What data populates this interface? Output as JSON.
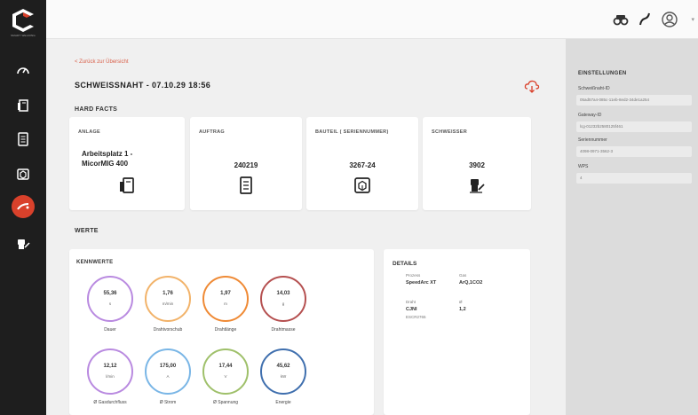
{
  "brand": {
    "logo_text": "SMART WELDING",
    "accent": "#d9412b"
  },
  "sidebar": {
    "items": [
      {
        "icon": "gauge-icon"
      },
      {
        "icon": "machine-icon"
      },
      {
        "icon": "document-icon"
      },
      {
        "icon": "package-icon"
      },
      {
        "icon": "weld-torch-icon",
        "active": true
      },
      {
        "icon": "welder-icon"
      }
    ]
  },
  "topbar": {
    "icons": [
      "binoculars-icon",
      "torch-icon",
      "user-icon"
    ]
  },
  "main": {
    "back_link": "< Zurück zur Übersicht",
    "title": "SCHWEISSNAHT - 07.10.29 18:56",
    "hard_facts_label": "HARD FACTS",
    "cards": [
      {
        "label": "ANLAGE",
        "value_line1": "Arbeitsplatz 1 -",
        "value_line2": "MicorMIG 400"
      },
      {
        "label": "AUFTRAG",
        "value": "240219"
      },
      {
        "label": "BAUTEIL ( SERIENNUMMER)",
        "value": "3267-24"
      },
      {
        "label": "SCHWEISSER",
        "value": "3902"
      }
    ],
    "werte_label": "WERTE",
    "kennwerte": {
      "title": "KENNWERTE",
      "gauges": [
        {
          "value": "55,36",
          "unit": "s",
          "name": "Dauer",
          "color": "#b98ae0"
        },
        {
          "value": "1,76",
          "unit": "m/min",
          "name": "Drahtvorschub",
          "color": "#f2b36a"
        },
        {
          "value": "1,97",
          "unit": "m",
          "name": "Drahtlänge",
          "color": "#ef8a35"
        },
        {
          "value": "14,03",
          "unit": "g",
          "name": "Drahtmasse",
          "color": "#b55050"
        },
        {
          "value": "12,12",
          "unit": "l/min",
          "name": "Ø Gasdurchfluss",
          "color": "#b98ae0"
        },
        {
          "value": "175,00",
          "unit": "A",
          "name": "Ø Strom",
          "color": "#7ab6e6"
        },
        {
          "value": "17,44",
          "unit": "V",
          "name": "Ø Spannung",
          "color": "#9fc06a"
        },
        {
          "value": "45,62",
          "unit": "kW",
          "name": "Energie",
          "color": "#3f6fae"
        }
      ]
    },
    "details": {
      "title": "DETAILS",
      "prozess_label": "Prozess",
      "prozess_value": "SpeedArc XT",
      "gas_label": "Gas",
      "gas_value": "ArQ,1CO2",
      "draht_label": "Draht",
      "draht_value1": "CJNI",
      "draht_value2": "ESCR2765",
      "durchmesser_label": "Ø",
      "durchmesser_value": "1,2"
    }
  },
  "settings": {
    "title": "EINSTELLUNGEN",
    "fields": [
      {
        "label": "Schweißnaht-ID",
        "value": "05ad57a4-085c-11eb-8ed2-34de1a254"
      },
      {
        "label": "Gateway-ID",
        "value": "lcg-01232b2580125f461"
      },
      {
        "label": "Seriennummer",
        "value": "4098-0971-3562-3"
      },
      {
        "label": "WPS",
        "value": "4"
      }
    ]
  }
}
